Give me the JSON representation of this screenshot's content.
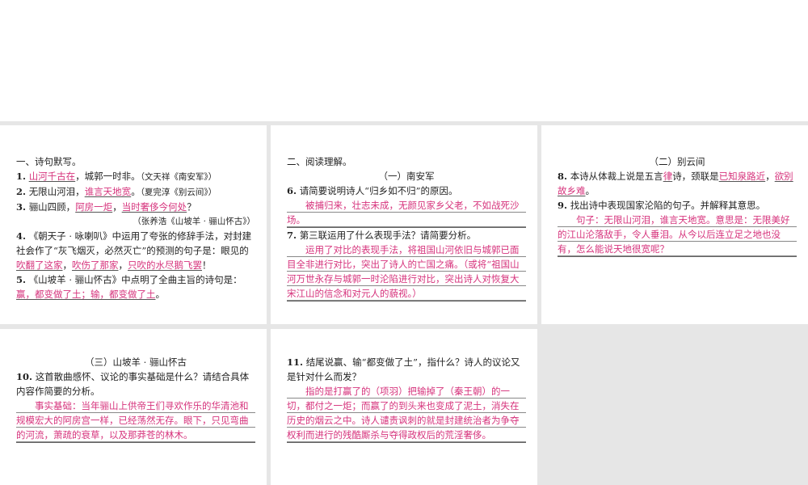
{
  "panel1": {
    "section_title": "一、诗句默写。",
    "q1": {
      "num": "1",
      "ans": "山河千古在",
      "text": "，城郭一时非。",
      "src": "（文天祥《南安军》）"
    },
    "q2": {
      "num": "2",
      "prefix": "无限山河泪，",
      "ans": "谁言天地宽",
      "text": "。",
      "src": "（夏完淳《别云间》）"
    },
    "q3": {
      "num": "3",
      "prefix": "骊山四顾，",
      "ans1": "阿房一炬",
      "mid": "，",
      "ans2": "当时奢侈今何处",
      "end": "？",
      "src": "（张养浩《山坡羊 · 骊山怀古》）"
    },
    "q4": {
      "num": "4",
      "text": "《朝天子 · 咏喇叭》中运用了夸张的修辞手法，对封建社会作了“灰飞烟灭，必然灭亡”的预测的句子是：眼见的",
      "ans1": "吹翻了这家",
      "sep1": "，",
      "ans2": "吹伤了那家",
      "sep2": "，",
      "ans3": "只吹的水尽鹅飞罢",
      "end": "！"
    },
    "q5": {
      "num": "5",
      "text": "《山坡羊 · 骊山怀古》中点明了全曲主旨的诗句是：",
      "ans": "赢，都变做了土；输，都变做了土",
      "end": "。"
    }
  },
  "panel2": {
    "section_title": "二、阅读理解。",
    "sub_title": "（一）南安军",
    "q6": {
      "num": "6",
      "text": "请简要说明诗人“归乡如不归”的原因。",
      "ans": "被捕归来，壮志未成，无颜见家乡父老，不如战死沙场。"
    },
    "q7": {
      "num": "7",
      "text": "第三联运用了什么表现手法？请简要分析。",
      "ans": "运用了对比的表现手法，将祖国山河依旧与城郭已面目全非进行对比，突出了诗人的亡国之痛。（或将“祖国山河万世永存与城郭一时沦陷进行对比，突出诗人对恢复大宋江山的信念和对元人的藐视。）"
    }
  },
  "panel3": {
    "sub_title": "（二）别云间",
    "q8": {
      "num": "8",
      "text1": "本诗从体裁上说是五言",
      "ans1": "律",
      "text2": "诗，颈联是",
      "ans2": "已知泉路近",
      "sep": "，",
      "ans3": "欲别故乡难",
      "end": "。"
    },
    "q9": {
      "num": "9",
      "text": "找出诗中表现国家沦陷的句子。并解释其意思。",
      "ans": "句子：无限山河泪，谁言天地宽。意思是：无限美好的江山沦落敌手，令人垂泪。从今以后连立足之地也没有，怎么能说天地很宽呢？"
    }
  },
  "panel4": {
    "sub_title": "（三）山坡羊 · 骊山怀古",
    "q10": {
      "num": "10",
      "text": "这首散曲感怀、议论的事实基础是什么？请结合具体内容作简要的分析。",
      "ans": "事实基础：当年骊山上供帝王们寻欢作乐的华清池和规模宏大的阿房宫一样，已经荡然无存。眼下，只见弯曲的河流，萧疏的衰草，以及那莽苍的林木。"
    }
  },
  "panel5": {
    "q11": {
      "num": "11",
      "text": "结尾说赢、输“都变做了土”，指什么？诗人的议论又是针对什么而发？",
      "ans": "指的是打赢了的（项羽）把输掉了（秦王朝）的一切，都付之一炬；而赢了的到头来也变成了泥土，消失在历史的烟云之中。诗人谴责讽刺的就是封建统治者为争夺权利而进行的残酷厮杀与夺得政权后的荒淫奢侈。"
    }
  }
}
